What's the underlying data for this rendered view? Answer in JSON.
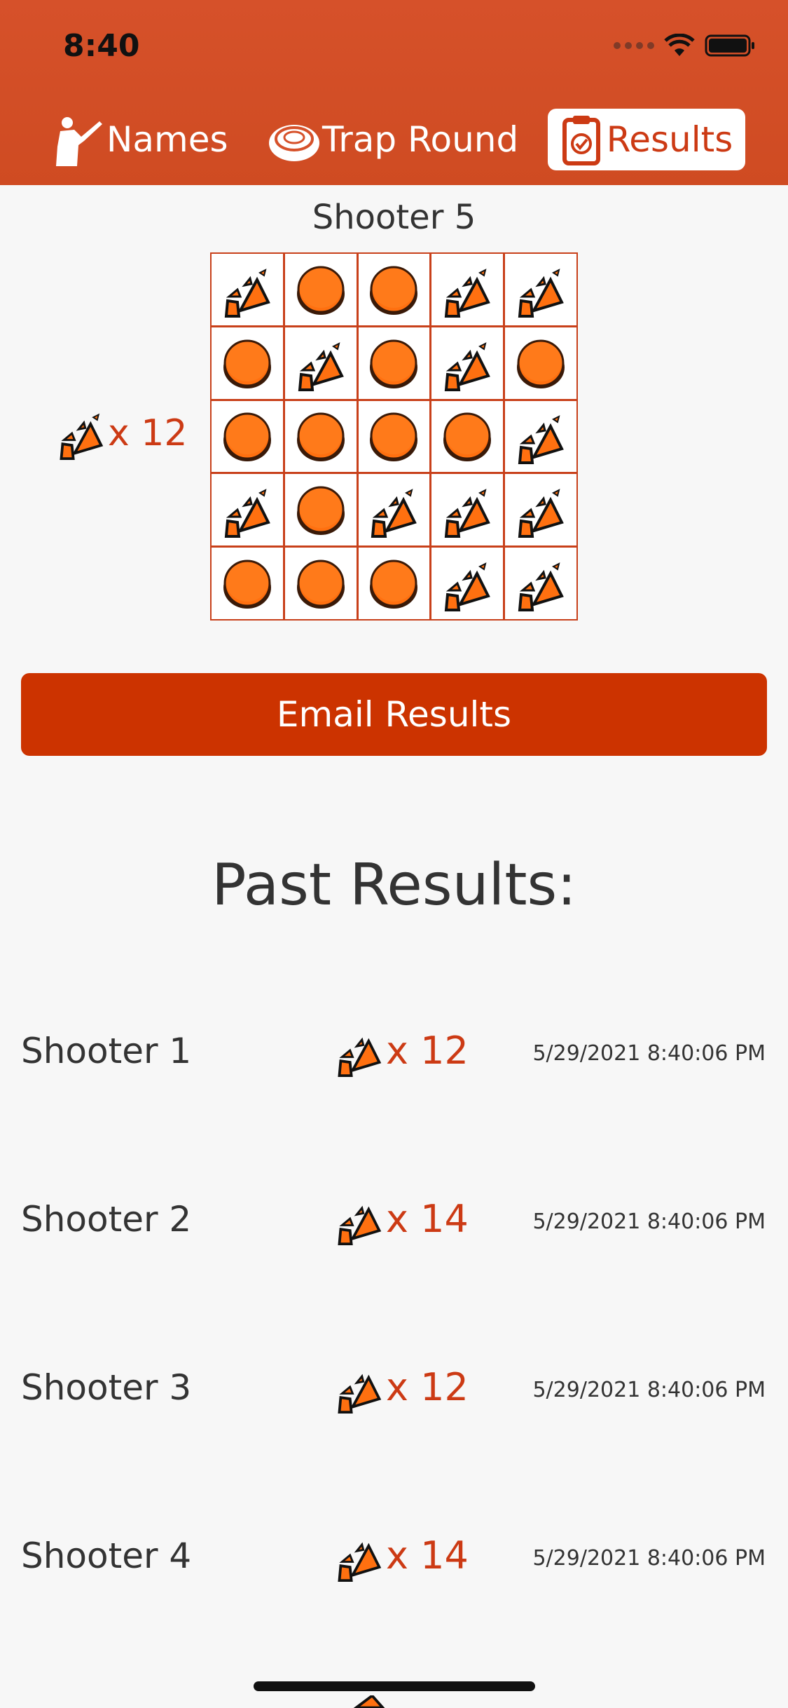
{
  "status_bar": {
    "time": "8:40"
  },
  "tabs": [
    {
      "label": "Names",
      "icon": "shooter-icon",
      "selected": false
    },
    {
      "label": "Trap Round",
      "icon": "clay-target-icon",
      "selected": false
    },
    {
      "label": "Results",
      "icon": "clipboard-check-icon",
      "selected": true
    }
  ],
  "current": {
    "shooter": "Shooter 5",
    "hits_text": "x 12",
    "grid": [
      [
        "hit",
        "miss",
        "miss",
        "hit",
        "hit"
      ],
      [
        "miss",
        "hit",
        "miss",
        "hit",
        "miss"
      ],
      [
        "miss",
        "miss",
        "miss",
        "miss",
        "hit"
      ],
      [
        "hit",
        "miss",
        "hit",
        "hit",
        "hit"
      ],
      [
        "miss",
        "miss",
        "miss",
        "hit",
        "hit"
      ]
    ]
  },
  "email_button": "Email Results",
  "past_title": "Past Results:",
  "past_results": [
    {
      "name": "Shooter 1",
      "score": "x 12",
      "date": "5/29/2021 8:40:06 PM"
    },
    {
      "name": "Shooter 2",
      "score": "x 14",
      "date": "5/29/2021 8:40:06 PM"
    },
    {
      "name": "Shooter 3",
      "score": "x 12",
      "date": "5/29/2021 8:40:06 PM"
    },
    {
      "name": "Shooter 4",
      "score": "x 14",
      "date": "5/29/2021 8:40:06 PM"
    }
  ],
  "colors": {
    "header": "#d6512a",
    "accent": "#cc3300",
    "clay": "#ff7010"
  }
}
